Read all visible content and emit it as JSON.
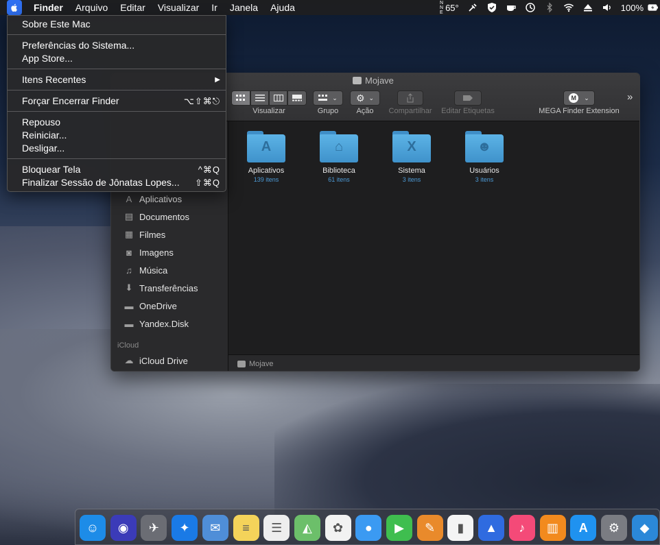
{
  "menubar": {
    "items": [
      "Finder",
      "Arquivo",
      "Editar",
      "Visualizar",
      "Ir",
      "Janela",
      "Ajuda"
    ],
    "status": {
      "weather": "65°",
      "battery": "100%"
    }
  },
  "apple_menu": {
    "about": "Sobre Este Mac",
    "prefs": "Preferências do Sistema...",
    "appstore": "App Store...",
    "recent": "Itens Recentes",
    "recent_arrow": "▶",
    "force_quit": "Forçar Encerrar Finder",
    "force_quit_sc": "⌥⇧⌘⎋",
    "sleep": "Repouso",
    "restart": "Reiniciar...",
    "shutdown": "Desligar...",
    "lock": "Bloquear Tela",
    "lock_sc": "^⌘Q",
    "logout": "Finalizar Sessão de Jônatas Lopes...",
    "logout_sc": "⇧⌘Q"
  },
  "finder": {
    "title": "Mojave",
    "toolbar": {
      "view_label": "Visualizar",
      "group_label": "Grupo",
      "action_label": "Ação",
      "share_label": "Compartilhar",
      "tags_label": "Editar Etiquetas",
      "mega_label": "MEGA Finder Extension",
      "more": "»"
    },
    "sidebar": {
      "items": [
        {
          "label": "Aplicativos",
          "icon": "A"
        },
        {
          "label": "Documentos",
          "icon": "▤"
        },
        {
          "label": "Filmes",
          "icon": "▦"
        },
        {
          "label": "Imagens",
          "icon": "◙"
        },
        {
          "label": "Música",
          "icon": "♫"
        },
        {
          "label": "Transferências",
          "icon": "⬇"
        },
        {
          "label": "OneDrive",
          "icon": "▬"
        },
        {
          "label": "Yandex.Disk",
          "icon": "▬"
        }
      ],
      "icloud_header": "iCloud",
      "icloud_drive": "iCloud Drive"
    },
    "folders": [
      {
        "name": "Aplicativos",
        "count": "139 itens",
        "glyph": "A"
      },
      {
        "name": "Biblioteca",
        "count": "61 itens",
        "glyph": "⌂"
      },
      {
        "name": "Sistema",
        "count": "3 itens",
        "glyph": "X"
      },
      {
        "name": "Usuários",
        "count": "3 itens",
        "glyph": "☻"
      }
    ],
    "pathbar": "Mojave"
  },
  "dock": {
    "apps": [
      {
        "name": "finder-icon",
        "glyph": "☺",
        "color": "#1d8ce8"
      },
      {
        "name": "siri-icon",
        "glyph": "◉",
        "color": "#3b3bb8"
      },
      {
        "name": "launchpad-icon",
        "glyph": "✈",
        "color": "#6b6d74"
      },
      {
        "name": "safari-icon",
        "glyph": "✦",
        "color": "#1a7ae6"
      },
      {
        "name": "mail-icon",
        "glyph": "✉",
        "color": "#4f8ed8"
      },
      {
        "name": "notes-icon",
        "glyph": "≡",
        "color": "#f4d35a"
      },
      {
        "name": "reminders-icon",
        "glyph": "☰",
        "color": "#eeeeee"
      },
      {
        "name": "maps-icon",
        "glyph": "◭",
        "color": "#6cbf6a"
      },
      {
        "name": "photos-icon",
        "glyph": "✿",
        "color": "#f2f2f2"
      },
      {
        "name": "messages-icon",
        "glyph": "●",
        "color": "#3b9af2"
      },
      {
        "name": "facetime-icon",
        "glyph": "▶",
        "color": "#3fbe4f"
      },
      {
        "name": "pages-icon",
        "glyph": "✎",
        "color": "#e98a2b"
      },
      {
        "name": "numbers-icon",
        "glyph": "▮",
        "color": "#f4f4f4"
      },
      {
        "name": "keynote-icon",
        "glyph": "▲",
        "color": "#2f6be0"
      },
      {
        "name": "itunes-icon",
        "glyph": "♪",
        "color": "#f44a78"
      },
      {
        "name": "books-icon",
        "glyph": "▥",
        "color": "#f28a1e"
      },
      {
        "name": "appstore-icon",
        "glyph": "A",
        "color": "#1f92f0"
      },
      {
        "name": "system-prefs-icon",
        "glyph": "⚙",
        "color": "#7a7c82"
      },
      {
        "name": "onedrive-icon",
        "glyph": "◆",
        "color": "#2b88d8"
      }
    ]
  }
}
